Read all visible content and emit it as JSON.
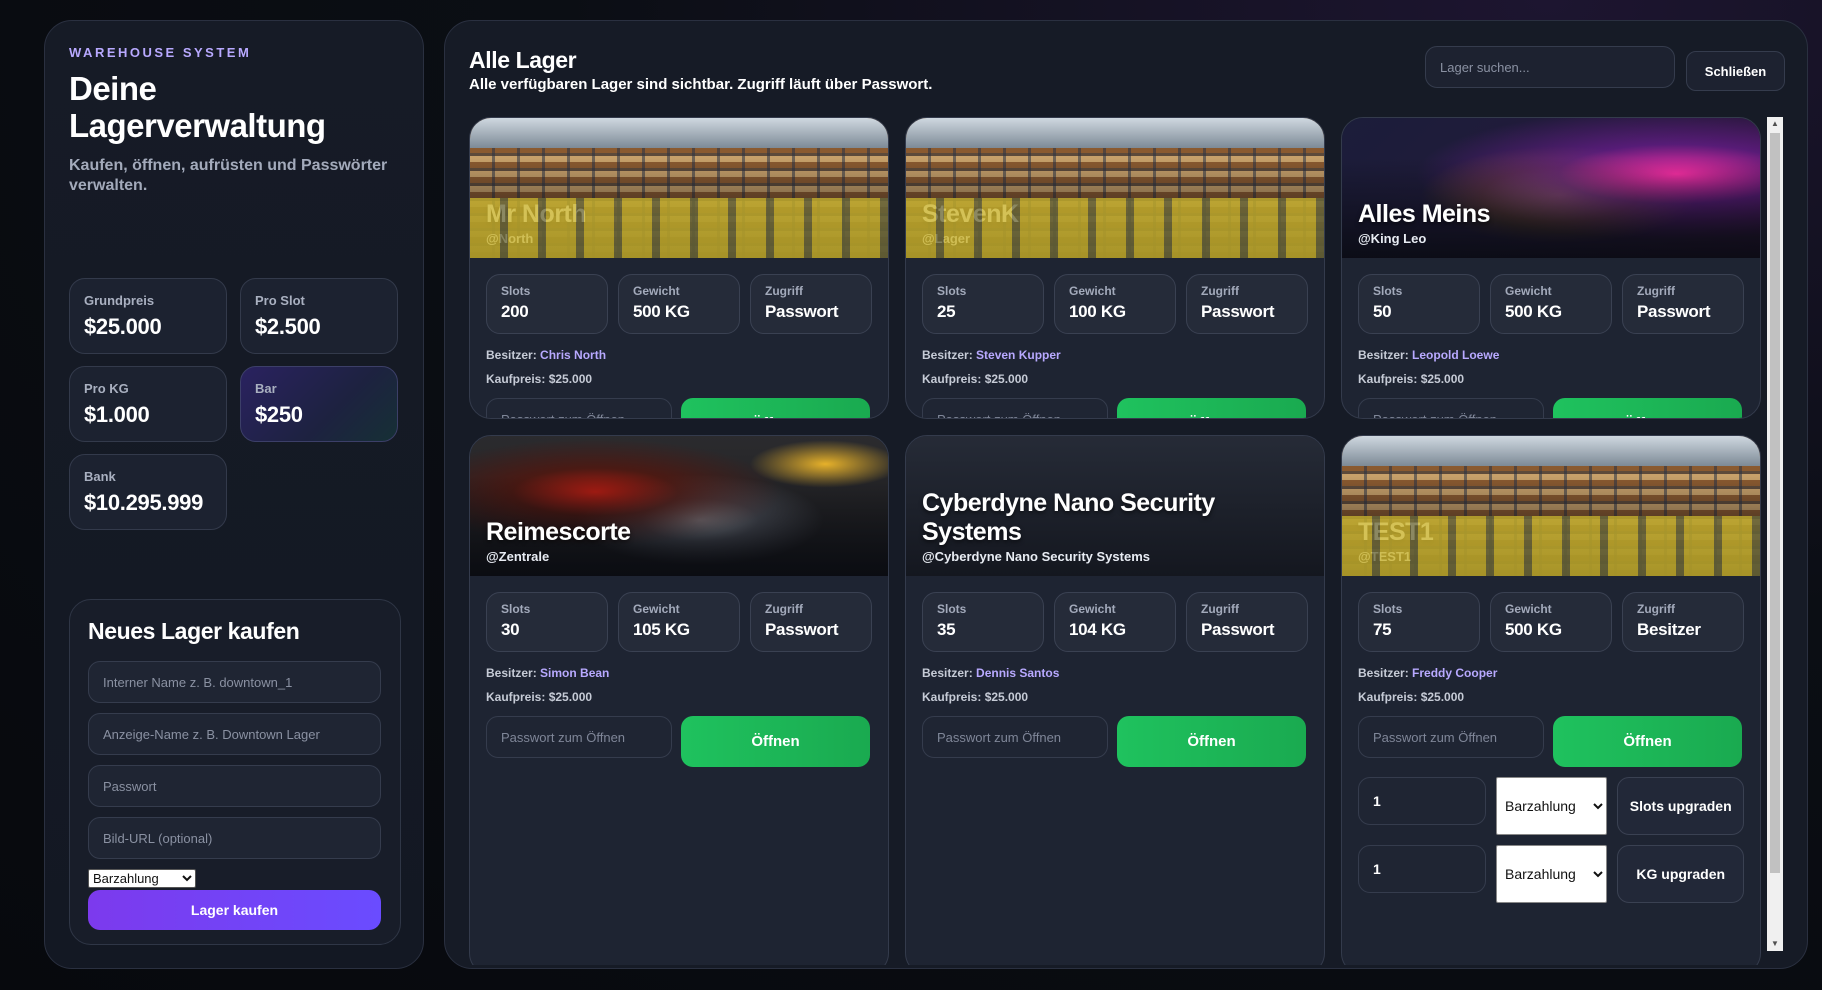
{
  "sidebar": {
    "brand": "WAREHOUSE SYSTEM",
    "title": "Deine Lagerverwaltung",
    "subtitle": "Kaufen, öffnen, aufrüsten und Passwörter verwalten.",
    "stats": [
      {
        "label": "Grundpreis",
        "value": "$25.000"
      },
      {
        "label": "Pro Slot",
        "value": "$2.500"
      },
      {
        "label": "Pro KG",
        "value": "$1.000"
      },
      {
        "label": "Bar",
        "value": "$250"
      },
      {
        "label": "Bank",
        "value": "$10.295.999"
      }
    ],
    "buy": {
      "title": "Neues Lager kaufen",
      "internal_name_placeholder": "Interner Name z. B. downtown_1",
      "display_name_placeholder": "Anzeige-Name z. B. Downtown Lager",
      "password_placeholder": "Passwort",
      "image_url_placeholder": "Bild-URL (optional)",
      "payment_selected": "Barzahlung",
      "button_label": "Lager kaufen"
    }
  },
  "main": {
    "title": "Alle Lager",
    "subtitle": "Alle verfügbaren Lager sind sichtbar. Zugriff läuft über Passwort.",
    "search_placeholder": "Lager suchen...",
    "close_label": "Schließen",
    "labels": {
      "slots": "Slots",
      "weight": "Gewicht",
      "access": "Zugriff",
      "owner_prefix": "Besitzer:",
      "price_prefix": "Kaufpreis:",
      "password_placeholder": "Passwort zum Öffnen",
      "open_label": "Öffnen"
    },
    "cards": [
      {
        "name": "Mr North",
        "handle": "@North",
        "slots": "200",
        "weight": "500 KG",
        "access": "Passwort",
        "owner": "Chris North",
        "price": "$25.000",
        "banner": "warehouse"
      },
      {
        "name": "StevenK",
        "handle": "@Lager",
        "slots": "25",
        "weight": "100 KG",
        "access": "Passwort",
        "owner": "Steven Kupper",
        "price": "$25.000",
        "banner": "warehouse"
      },
      {
        "name": "Alles Meins",
        "handle": "@King Leo",
        "slots": "50",
        "weight": "500 KG",
        "access": "Passwort",
        "owner": "Leopold Loewe",
        "price": "$25.000",
        "banner": "lion"
      },
      {
        "name": "Reimescorte",
        "handle": "@Zentrale",
        "slots": "30",
        "weight": "105 KG",
        "access": "Passwort",
        "owner": "Simon Bean",
        "price": "$25.000",
        "banner": "grunge"
      },
      {
        "name": "Cyberdyne Nano Security Systems",
        "handle": "@Cyberdyne Nano Security Systems",
        "slots": "35",
        "weight": "104 KG",
        "access": "Passwort",
        "owner": "Dennis Santos",
        "price": "$25.000",
        "banner": "dark"
      },
      {
        "name": "TEST1",
        "handle": "@TEST1",
        "slots": "75",
        "weight": "500 KG",
        "access": "Besitzer",
        "owner": "Freddy Cooper",
        "price": "$25.000",
        "banner": "warehouse"
      }
    ],
    "upgrades": [
      {
        "amount": "1",
        "payment": "Barzahlung",
        "button": "Slots upgraden"
      },
      {
        "amount": "1",
        "payment": "Barzahlung",
        "button": "KG upgraden"
      }
    ]
  },
  "colors": {
    "accent_purple": "#7c3aed",
    "open_green": "#1fc25e",
    "owner_link": "#b8a9ff"
  }
}
